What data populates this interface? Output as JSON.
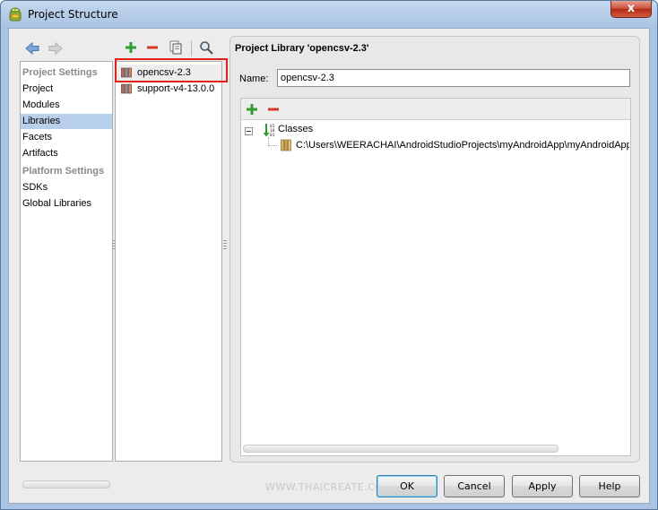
{
  "window": {
    "title": "Project Structure",
    "close_glyph": "x"
  },
  "settings": {
    "project_settings_header": "Project Settings",
    "items": [
      {
        "label": "Project"
      },
      {
        "label": "Modules"
      },
      {
        "label": "Libraries",
        "selected": true
      },
      {
        "label": "Facets"
      },
      {
        "label": "Artifacts"
      }
    ],
    "platform_settings_header": "Platform Settings",
    "platform_items": [
      {
        "label": "SDKs"
      },
      {
        "label": "Global Libraries"
      }
    ]
  },
  "libraries": {
    "items": [
      {
        "label": "opencsv-2.3",
        "selected": true
      },
      {
        "label": "support-v4-13.0.0"
      }
    ]
  },
  "library_panel": {
    "title": "Project Library 'opencsv-2.3'",
    "name_label": "Name:",
    "name_value": "opencsv-2.3",
    "tree": {
      "root_label": "Classes",
      "child_path": "C:\\Users\\WEERACHAI\\AndroidStudioProjects\\myAndroidApp\\myAndroidApp\\li"
    }
  },
  "watermark": "WWW.THAICREATE.COM",
  "buttons": {
    "ok": "OK",
    "cancel": "Cancel",
    "apply": "Apply",
    "help": "Help"
  },
  "colors": {
    "selection": "#b8cfe9",
    "add_green": "#2f9e2f",
    "remove_red": "#d23a2a",
    "highlight_red": "#e0201a"
  }
}
